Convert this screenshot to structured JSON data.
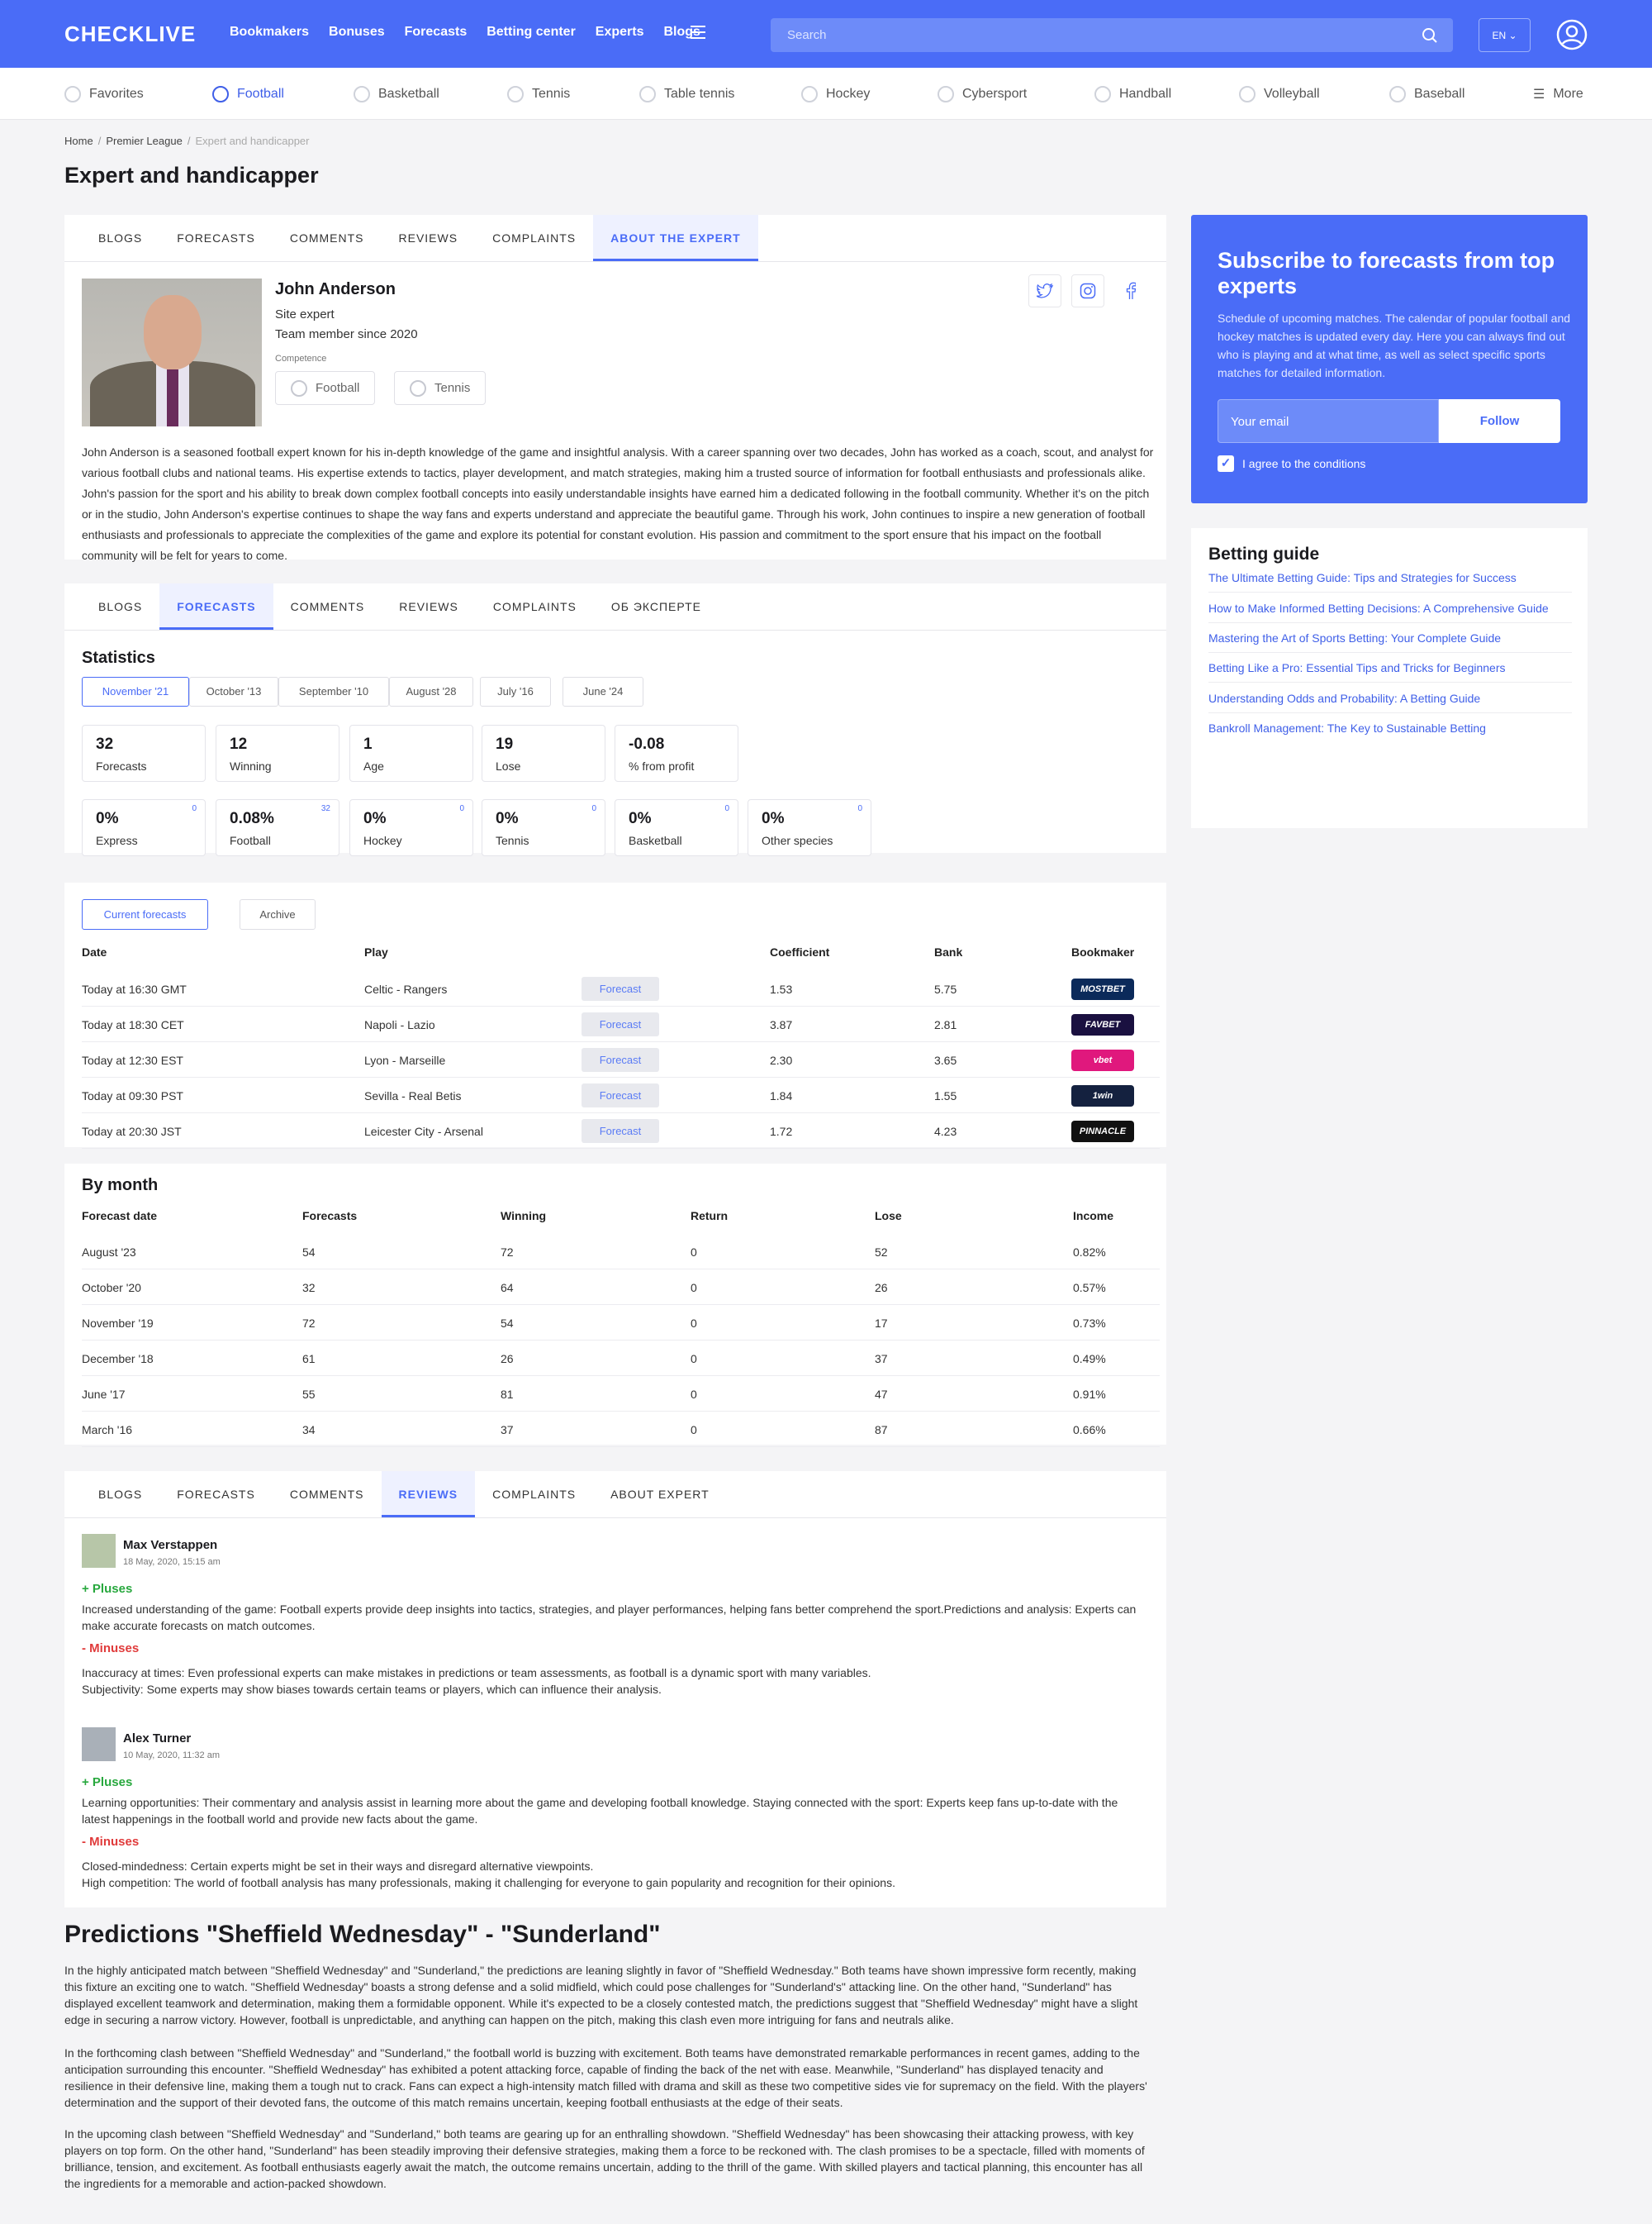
{
  "header": {
    "logo": "CHECKLIVE",
    "nav": [
      "Bookmakers",
      "Bonuses",
      "Forecasts",
      "Betting center",
      "Experts",
      "Blogs"
    ],
    "search_placeholder": "Search",
    "lang": "EN"
  },
  "sports": [
    "Favorites",
    "Football",
    "Basketball",
    "Tennis",
    "Table tennis",
    "Hockey",
    "Cybersport",
    "Handball",
    "Volleyball",
    "Baseball",
    "More"
  ],
  "breadcrumb": [
    "Home",
    "Premier League",
    "Expert and handicapper"
  ],
  "page_title": "Expert and handicapper",
  "tabs1": [
    "Blogs",
    "Forecasts",
    "Comments",
    "Reviews",
    "Complaints",
    "About the expert"
  ],
  "expert": {
    "name": "John Anderson",
    "role": "Site expert",
    "since": "Team member since 2020",
    "competence_label": "Competence",
    "competence": [
      "Football",
      "Tennis"
    ],
    "bio": "John Anderson is a seasoned football expert known for his in-depth knowledge of the game and insightful analysis. With a career spanning over two decades, John has worked as a coach, scout, and analyst for various football clubs and national teams. His expertise extends to tactics, player development, and match strategies, making him a trusted source of information for football enthusiasts and professionals alike. John's passion for the sport and his ability to break down complex football concepts into easily understandable insights have earned him a dedicated following in the football community. Whether it's on the pitch or in the studio, John Anderson's expertise continues to shape the way fans and experts understand and appreciate the beautiful game. Through his work, John continues to inspire a new generation of football enthusiasts and professionals to appreciate the complexities of the game and explore its potential for constant evolution. His passion and commitment to the sport ensure that his impact on the football community will be felt for years to come."
  },
  "subscribe": {
    "title": "Subscribe to forecasts from top experts",
    "text": "Schedule of upcoming matches. The calendar of popular football and hockey matches is updated every day. Here you can always find out who is playing and at what time, as well as select specific sports matches for detailed information.",
    "email_placeholder": "Your email",
    "follow": "Follow",
    "agree": "I agree to the conditions"
  },
  "guide": {
    "title": "Betting guide",
    "links": [
      "The Ultimate Betting Guide: Tips and Strategies for Success",
      "How to Make Informed Betting Decisions: A Comprehensive Guide",
      "Mastering the Art of Sports Betting: Your Complete Guide",
      "Betting Like a Pro: Essential Tips and Tricks for Beginners",
      "Understanding Odds and Probability: A Betting Guide",
      "Bankroll Management: The Key to Sustainable Betting"
    ]
  },
  "tabs2": [
    "Blogs",
    "Forecasts",
    "Comments",
    "Reviews",
    "Complaints",
    "Об эксперте"
  ],
  "statistics": {
    "title": "Statistics",
    "periods": [
      "November '21",
      "October '13",
      "September '10",
      "August '28",
      "July '16",
      "June '24"
    ],
    "main": [
      {
        "v": "32",
        "l": "Forecasts"
      },
      {
        "v": "12",
        "l": "Winning"
      },
      {
        "v": "1",
        "l": "Age"
      },
      {
        "v": "19",
        "l": "Lose"
      },
      {
        "v": "-0.08",
        "l": "% from profit"
      }
    ],
    "sports": [
      {
        "v": "0%",
        "l": "Express",
        "c": "0"
      },
      {
        "v": "0.08%",
        "l": "Football",
        "c": "32"
      },
      {
        "v": "0%",
        "l": "Hockey",
        "c": "0"
      },
      {
        "v": "0%",
        "l": "Tennis",
        "c": "0"
      },
      {
        "v": "0%",
        "l": "Basketball",
        "c": "0"
      },
      {
        "v": "0%",
        "l": "Other species",
        "c": "0"
      }
    ]
  },
  "forecasts": {
    "current": "Current forecasts",
    "archive": "Archive",
    "headers": [
      "Date",
      "Play",
      "Coefficient",
      "Bank",
      "Bookmaker"
    ],
    "forecast_btn": "Forecast",
    "rows": [
      {
        "date": "Today at 16:30 GMT",
        "play": "Celtic - Rangers",
        "coef": "1.53",
        "bank": "5.75",
        "bm": "MOSTBET",
        "color": "#0b2a5a"
      },
      {
        "date": "Today at 18:30 CET",
        "play": "Napoli - Lazio",
        "coef": "3.87",
        "bank": "2.81",
        "bm": "FAVBET",
        "color": "#1a1040"
      },
      {
        "date": "Today at 12:30 EST",
        "play": "Lyon - Marseille",
        "coef": "2.30",
        "bank": "3.65",
        "bm": "vbet",
        "color": "#e0187d"
      },
      {
        "date": "Today at 09:30 PST",
        "play": "Sevilla - Real Betis",
        "coef": "1.84",
        "bank": "1.55",
        "bm": "1win",
        "color": "#14213f"
      },
      {
        "date": "Today at 20:30 JST",
        "play": "Leicester City - Arsenal",
        "coef": "1.72",
        "bank": "4.23",
        "bm": "PINNACLE",
        "color": "#111"
      }
    ]
  },
  "by_month": {
    "title": "By month",
    "headers": [
      "Forecast date",
      "Forecasts",
      "Winning",
      "Return",
      "Lose",
      "Income"
    ],
    "rows": [
      [
        "August '23",
        "54",
        "72",
        "0",
        "52",
        "0.82%"
      ],
      [
        "October '20",
        "32",
        "64",
        "0",
        "26",
        "0.57%"
      ],
      [
        "November '19",
        "72",
        "54",
        "0",
        "17",
        "0.73%"
      ],
      [
        "December '18",
        "61",
        "26",
        "0",
        "37",
        "0.49%"
      ],
      [
        "June '17",
        "55",
        "81",
        "0",
        "47",
        "0.91%"
      ],
      [
        "March '16",
        "34",
        "37",
        "0",
        "87",
        "0.66%"
      ]
    ]
  },
  "tabs3": [
    "Blogs",
    "Forecasts",
    "Comments",
    "Reviews",
    "Complaints",
    "About expert"
  ],
  "reviews": [
    {
      "name": "Max Verstappen",
      "date": "18 May, 2020, 15:15 am",
      "plus_label": "+ Pluses",
      "plus": "Increased understanding of the game: Football experts provide deep insights into tactics, strategies, and player performances, helping fans better comprehend the sport.Predictions and analysis: Experts can make accurate forecasts on match outcomes.",
      "minus_label": "- Minuses",
      "minus": "Inaccuracy at times: Even professional experts can make mistakes in predictions or team assessments, as football is a dynamic sport with many variables.\nSubjectivity: Some experts may show biases towards certain teams or players, which can influence their analysis."
    },
    {
      "name": "Alex Turner",
      "date": "10 May, 2020, 11:32 am",
      "plus_label": "+ Pluses",
      "plus": "Learning opportunities: Their commentary and analysis assist in learning more about the game and developing football knowledge. Staying connected with the sport: Experts keep fans up-to-date with the latest happenings in the football world and provide new facts about the game.",
      "minus_label": "- Minuses",
      "minus": "Closed-mindedness: Certain experts might be set in their ways and disregard alternative viewpoints.\nHigh competition: The world of football analysis has many professionals, making it challenging for everyone to gain popularity and recognition for their opinions."
    }
  ],
  "predictions": {
    "title": "Predictions \"Sheffield Wednesday\" - \"Sunderland\"",
    "p1": "In the highly anticipated match between \"Sheffield Wednesday\" and \"Sunderland,\" the predictions are leaning slightly in favor of \"Sheffield Wednesday.\" Both teams have shown impressive form recently, making this fixture an exciting one to watch. \"Sheffield Wednesday\" boasts a strong defense and a solid midfield, which could pose challenges for \"Sunderland's\" attacking line. On the other hand, \"Sunderland\" has displayed excellent teamwork and determination, making them a formidable opponent. While it's expected to be a closely contested match, the predictions suggest that \"Sheffield Wednesday\" might have a slight edge in securing a narrow victory. However, football is unpredictable, and anything can happen on the pitch, making this clash even more intriguing for fans and neutrals alike.",
    "p2": "In the forthcoming clash between \"Sheffield Wednesday\" and \"Sunderland,\" the football world is buzzing with excitement. Both teams have demonstrated remarkable performances in recent games, adding to the anticipation surrounding this encounter. \"Sheffield Wednesday\" has exhibited a potent attacking force, capable of finding the back of the net with ease. Meanwhile, \"Sunderland\" has displayed tenacity and resilience in their defensive line, making them a tough nut to crack. Fans can expect a high-intensity match filled with drama and skill as these two competitive sides vie for supremacy on the field. With the players' determination and the support of their devoted fans, the outcome of this match remains uncertain, keeping football enthusiasts at the edge of their seats.",
    "p3": "In the upcoming clash between \"Sheffield Wednesday\" and \"Sunderland,\" both teams are gearing up for an enthralling showdown. \"Sheffield Wednesday\" has been showcasing their attacking prowess, with key players on top form. On the other hand, \"Sunderland\" has been steadily improving their defensive strategies, making them a force to be reckoned with. The clash promises to be a spectacle, filled with moments of brilliance, tension, and excitement. As football enthusiasts eagerly await the match, the outcome remains uncertain, adding to the thrill of the game. With skilled players and tactical planning, this encounter has all the ingredients for a memorable and action-packed showdown."
  }
}
